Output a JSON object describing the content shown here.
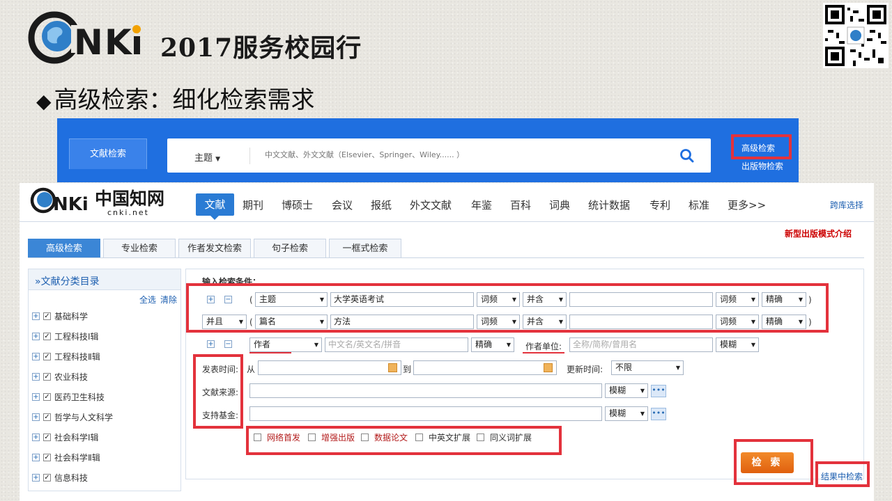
{
  "slide": {
    "logo_text": "CNKI",
    "year_title": "2017服务校园行",
    "subtitle": "高级检索：细化检索需求"
  },
  "top_search": {
    "tab_label": "文献检索",
    "field_select": "主题",
    "placeholder": "中文文献、外文文献（Elsevier、Springer、Wiley...... ）",
    "advanced_link": "高级检索",
    "publication_link": "出版物检索"
  },
  "site": {
    "logo_cn": "中国知网",
    "logo_url": "cnki.net",
    "nav": [
      "文献",
      "期刊",
      "博硕士",
      "会议",
      "报纸",
      "外文文献",
      "年鉴",
      "百科",
      "词典",
      "统计数据",
      "专利",
      "标准",
      "更多>>"
    ],
    "cross_db": "跨库选择",
    "new_model": "新型出版模式介绍"
  },
  "subtabs": [
    "高级检索",
    "专业检索",
    "作者发文检索",
    "句子检索",
    "一框式检索"
  ],
  "category": {
    "title": "»文献分类目录",
    "select_all": "全选",
    "clear": "清除",
    "items": [
      "基础科学",
      "工程科技Ⅰ辑",
      "工程科技Ⅱ辑",
      "农业科技",
      "医药卫生科技",
      "哲学与人文科学",
      "社会科学Ⅰ辑",
      "社会科学Ⅱ辑",
      "信息科技"
    ]
  },
  "conditions": {
    "label": "输入检索条件：",
    "row1": {
      "paren_open": "(",
      "field": "主题",
      "value": "大学英语考试",
      "freq": "词频",
      "combine": "并含",
      "value2": "",
      "freq2": "词频",
      "match": "精确",
      "paren_close": ")"
    },
    "row2": {
      "logic": "并且",
      "paren_open": "(",
      "field": "篇名",
      "value": "方法",
      "freq": "词频",
      "combine": "并含",
      "value2": "",
      "freq2": "词频",
      "match": "精确",
      "paren_close": ")"
    },
    "author_row": {
      "field": "作者",
      "placeholder": "中文名/英文名/拼音",
      "match": "精确",
      "unit_label": "作者单位:",
      "unit_placeholder": "全称/简称/曾用名",
      "unit_match": "模糊"
    },
    "date": {
      "label": "发表时间:",
      "from": "从",
      "to": "到",
      "update_label": "更新时间:",
      "update_value": "不限"
    },
    "source": {
      "label": "文献来源:",
      "match": "模糊"
    },
    "fund": {
      "label": "支持基金:",
      "match": "模糊"
    },
    "options": [
      "网络首发",
      "增强出版",
      "数据论文",
      "中英文扩展",
      "同义词扩展"
    ],
    "search_button": "检 索",
    "in_result": "结果中检索"
  },
  "colors": {
    "accent": "#1f6fe0",
    "highlight": "#e3323c",
    "button": "#e86b16",
    "red_option": "#b31b1b"
  }
}
